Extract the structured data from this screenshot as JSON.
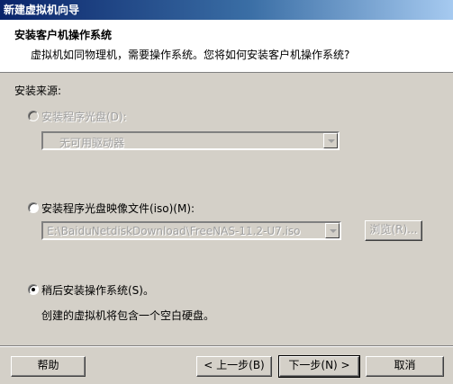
{
  "window": {
    "title": "新建虚拟机向导"
  },
  "header": {
    "title": "安装客户机操作系统",
    "subtitle": "虚拟机如同物理机，需要操作系统。您将如何安装客户机操作系统?"
  },
  "install_source": {
    "label": "安装来源:",
    "option_disc": {
      "label": "安装程序光盘(D):",
      "selected": false,
      "enabled": false,
      "drive_value": "无可用驱动器"
    },
    "option_iso": {
      "label": "安装程序光盘映像文件(iso)(M):",
      "selected": false,
      "path_value": "E:\\BaiduNetdiskDownload\\FreeNAS-11.2-U7.iso",
      "browse_label": "浏览(R)..."
    },
    "option_later": {
      "label": "稍后安装操作系统(S)。",
      "selected": true,
      "description": "创建的虚拟机将包含一个空白硬盘。"
    }
  },
  "buttons": {
    "help": "帮助",
    "back": "< 上一步(B)",
    "next": "下一步(N) >",
    "cancel": "取消"
  }
}
